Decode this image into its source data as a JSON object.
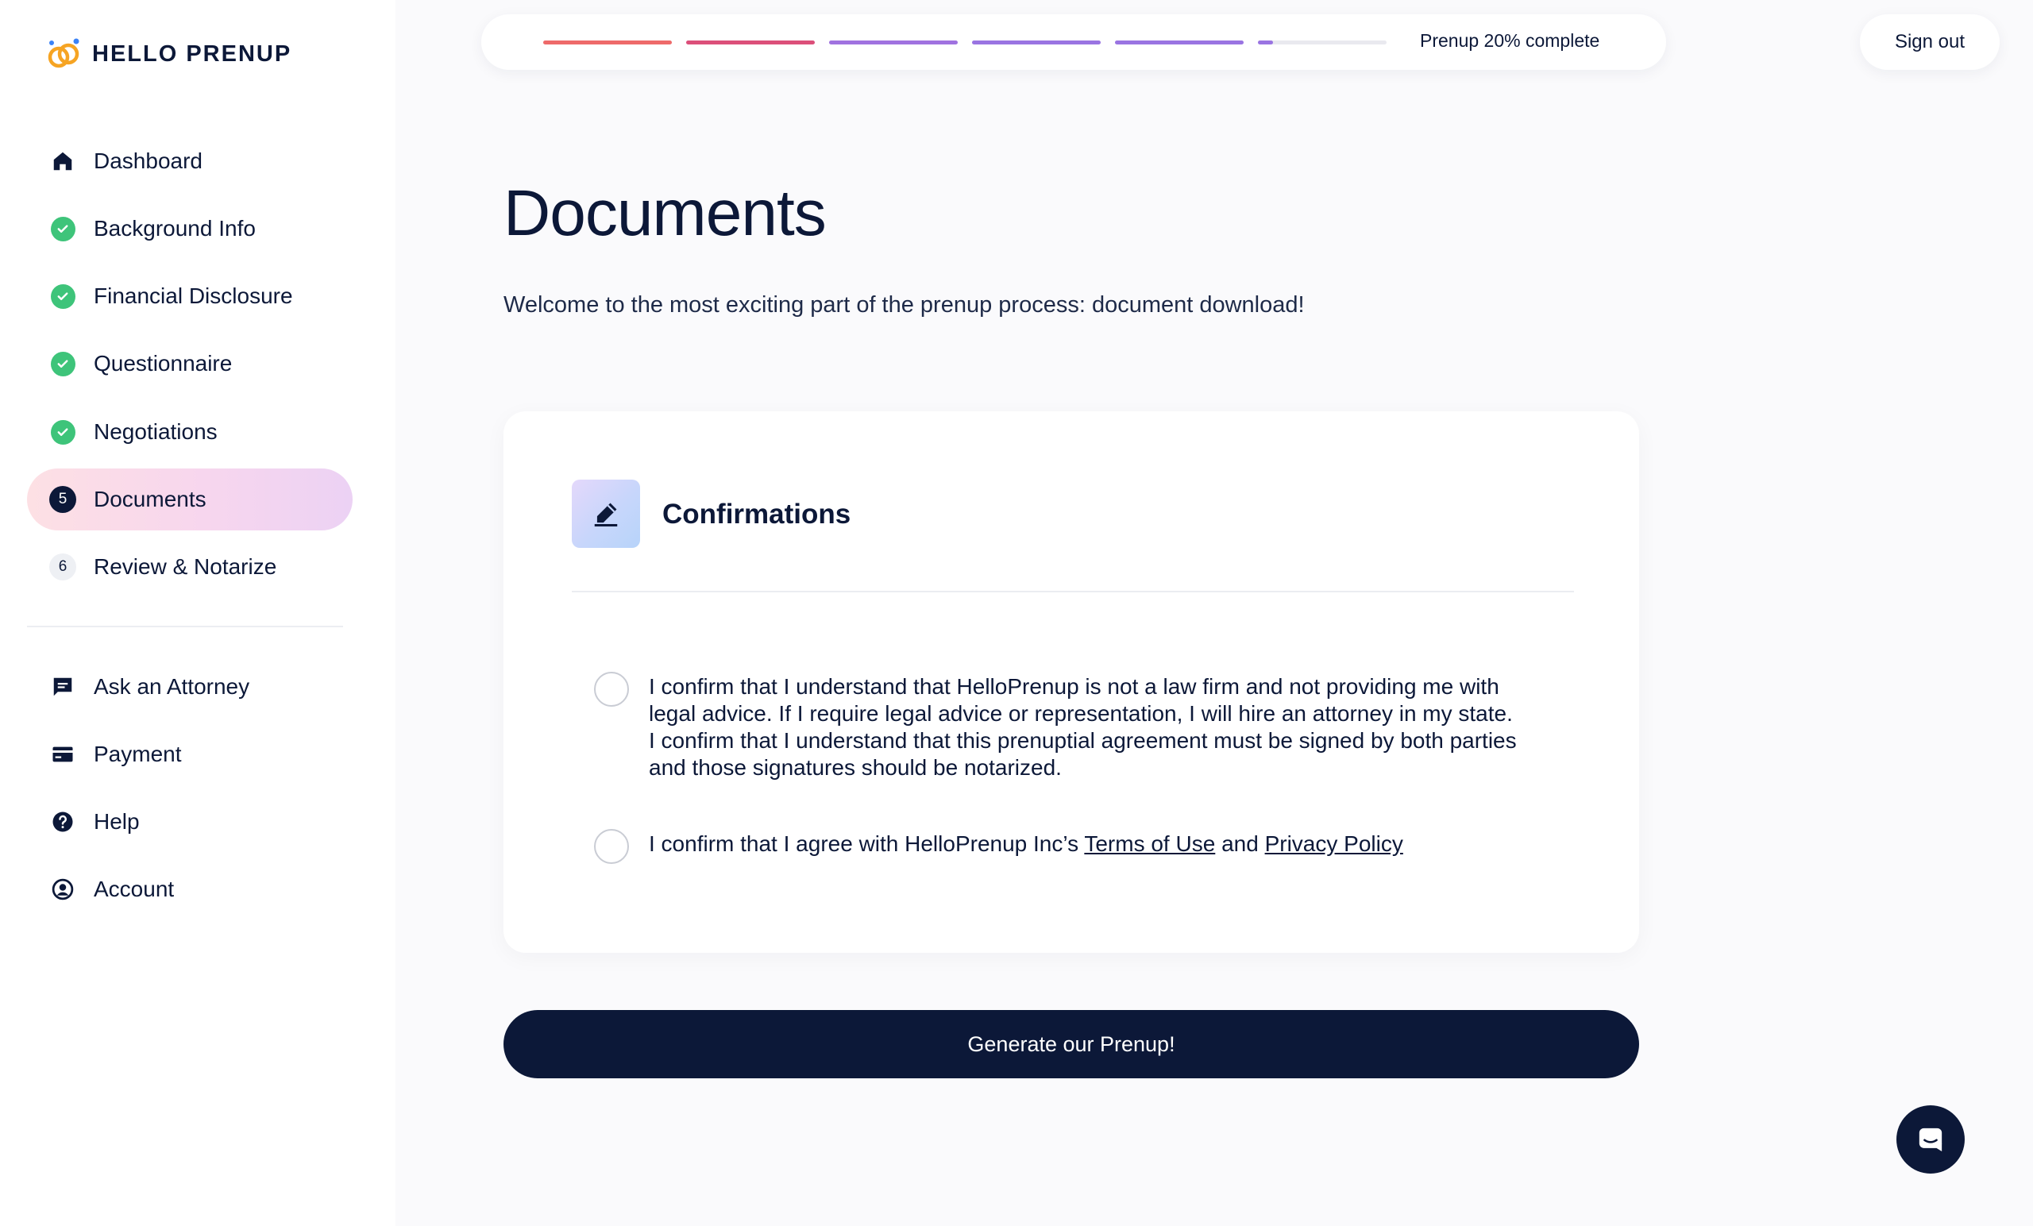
{
  "brand": {
    "name": "HELLO PRENUP",
    "colors": {
      "navy": "#0c1838",
      "check_green": "#3ec47a",
      "logo_orange": "#f6a423",
      "logo_blue": "#3b82f6"
    }
  },
  "sidebar": {
    "steps": [
      {
        "label": "Dashboard",
        "icon": "home-icon",
        "status": "link"
      },
      {
        "label": "Background Info",
        "icon": "check-circle-icon",
        "status": "complete"
      },
      {
        "label": "Financial Disclosure",
        "icon": "check-circle-icon",
        "status": "complete"
      },
      {
        "label": "Questionnaire",
        "icon": "check-circle-icon",
        "status": "complete"
      },
      {
        "label": "Negotiations",
        "icon": "check-circle-icon",
        "status": "complete"
      },
      {
        "label": "Documents",
        "number": "5",
        "status": "active"
      },
      {
        "label": "Review & Notarize",
        "number": "6",
        "status": "upcoming"
      }
    ],
    "secondary": [
      {
        "label": "Ask an Attorney",
        "icon": "chat-icon"
      },
      {
        "label": "Payment",
        "icon": "credit-card-icon"
      },
      {
        "label": "Help",
        "icon": "help-icon"
      },
      {
        "label": "Account",
        "icon": "account-icon"
      }
    ]
  },
  "progress": {
    "label": "Prenup 20% complete",
    "segments": [
      {
        "color": "#ee6a6a",
        "fill": 1.0
      },
      {
        "color": "#dc4f7a",
        "fill": 1.0
      },
      {
        "color": "#a072e0",
        "fill": 1.0
      },
      {
        "color": "#9a74e2",
        "fill": 1.0
      },
      {
        "color": "#9a74e2",
        "fill": 1.0
      },
      {
        "color": "#9a74e2",
        "fill": 0.12
      }
    ]
  },
  "header": {
    "signout_label": "Sign out"
  },
  "main": {
    "title": "Documents",
    "subtitle": "Welcome to the most exciting part of the prenup process: document download!",
    "card": {
      "title": "Confirmations",
      "icon": "edit-icon",
      "confirmations": [
        {
          "lines": [
            "I confirm that I understand that HelloPrenup is not a law firm and not providing me with",
            "legal advice. If I require legal advice or representation, I will hire an attorney in my state.",
            "I confirm that I understand that this prenuptial agreement must be signed by both parties",
            "and those signatures should be notarized."
          ],
          "checked": false
        },
        {
          "prefix": "I confirm that I agree with HelloPrenup Inc’s",
          "link1": "Terms of Use",
          "middle": "and",
          "link2": "Privacy Policy",
          "checked": false
        }
      ]
    },
    "generate_label": "Generate our Prenup!"
  },
  "chat": {
    "icon": "chat-launcher-icon"
  }
}
